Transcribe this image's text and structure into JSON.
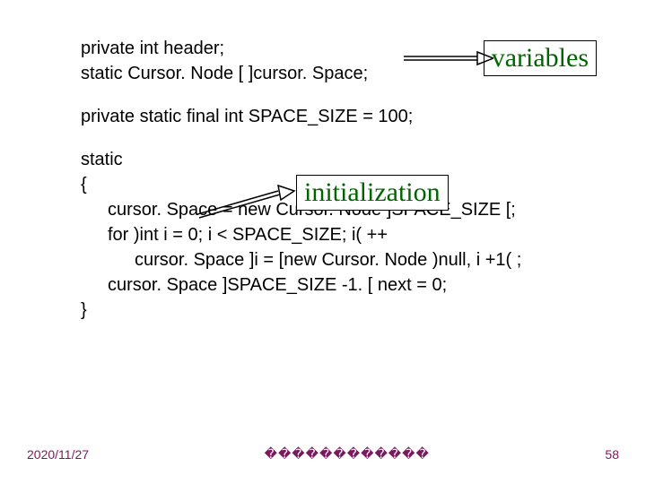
{
  "code": {
    "l1": "private int header;",
    "l2": "static Cursor. Node [  ]cursor. Space;",
    "l3": "private static final int SPACE_SIZE  = 100;",
    "l4": "static",
    "l5": "{",
    "l6": "cursor. Space  = new Cursor. Node ]SPACE_SIZE [;",
    "l7": "for )int i  = 0; i < SPACE_SIZE; i( ++",
    "l8": "cursor. Space ]i  = [new Cursor. Node )null, i  +1(  ;",
    "l9": "cursor. Space ]SPACE_SIZE  -1. [ next  = 0;",
    "l10": "}"
  },
  "labels": {
    "variables": "variables",
    "initialization": "initialization"
  },
  "footer": {
    "date": "2020/11/27",
    "center": "������������",
    "page": "58"
  }
}
